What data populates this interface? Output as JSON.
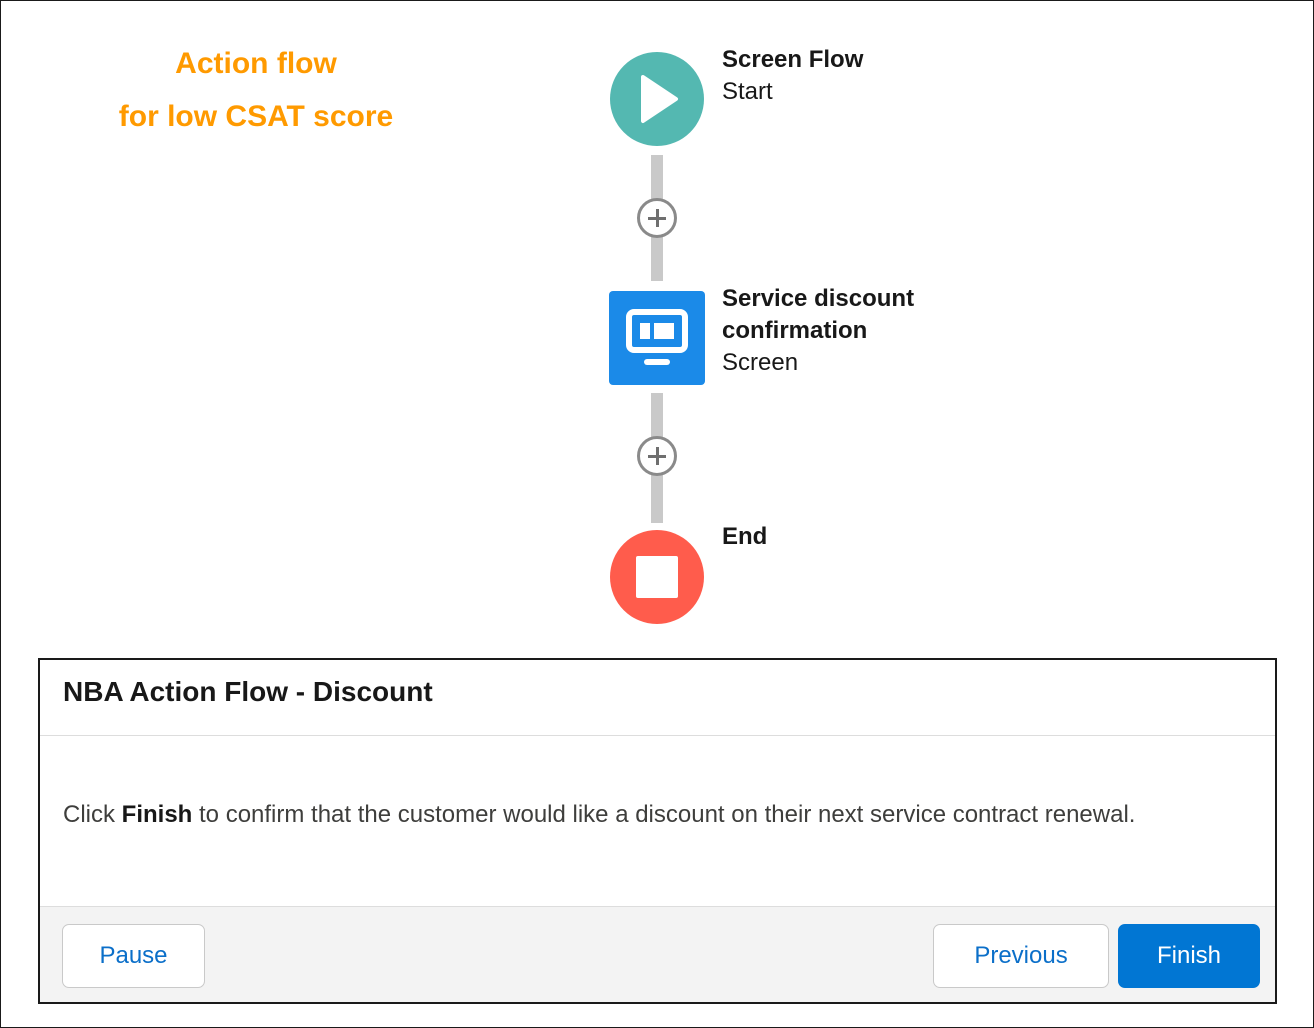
{
  "caption": {
    "line1": "Action flow",
    "line2": "for low CSAT score",
    "color": "#ff9a00"
  },
  "flow": {
    "start": {
      "title": "Screen Flow",
      "subtitle": "Start",
      "icon": "play-icon",
      "color": "#54b8b1"
    },
    "screen": {
      "title_line1": "Service discount",
      "title_line2": "confirmation",
      "subtitle": "Screen",
      "icon": "screen-icon",
      "color": "#1b8ae8"
    },
    "end": {
      "title": "End",
      "icon": "stop-icon",
      "color": "#ff5c4c"
    },
    "add_icon": "plus-circle-icon"
  },
  "panel": {
    "title": "NBA Action Flow - Discount",
    "body_prefix": "Click ",
    "body_bold": "Finish",
    "body_suffix": " to confirm that the customer would like a discount on their next service contract renewal.",
    "buttons": {
      "pause": "Pause",
      "previous": "Previous",
      "finish": "Finish"
    },
    "brand_color": "#0176d3"
  }
}
